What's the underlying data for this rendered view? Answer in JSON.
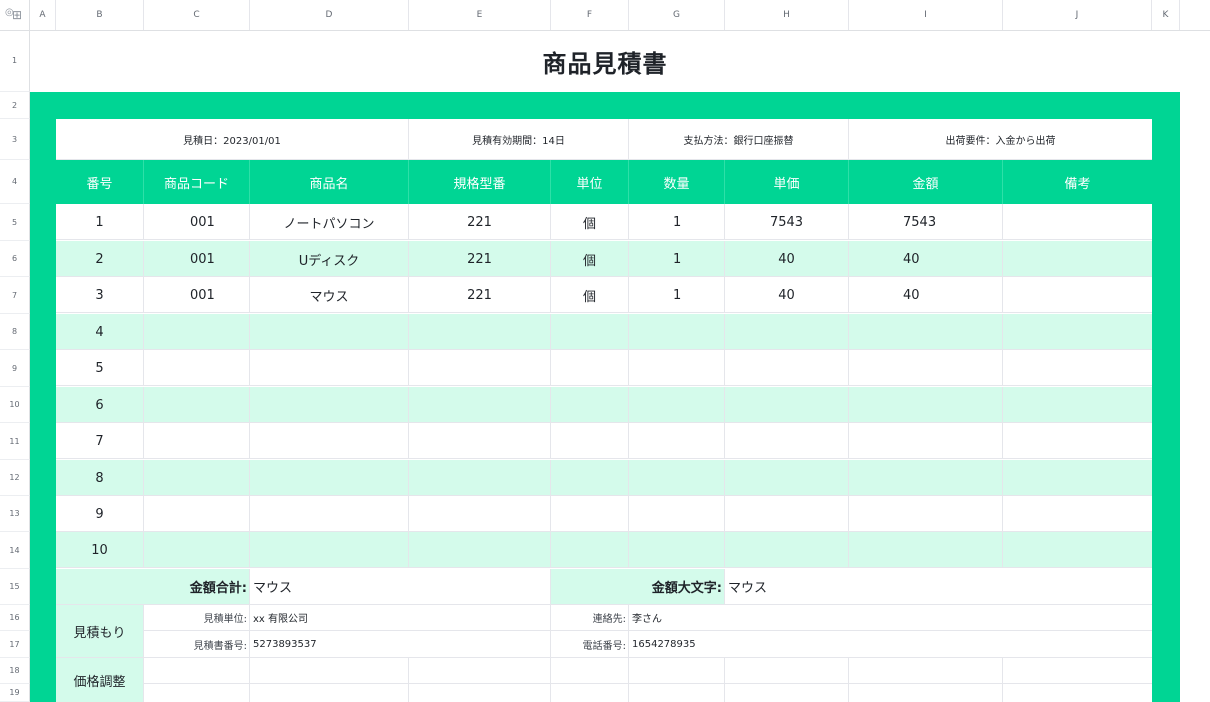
{
  "column_headers": [
    "A",
    "B",
    "C",
    "D",
    "E",
    "F",
    "G",
    "H",
    "I",
    "J",
    "K"
  ],
  "row_numbers": [
    "1",
    "2",
    "3",
    "4",
    "5",
    "6",
    "7",
    "8",
    "9",
    "10",
    "11",
    "12",
    "13",
    "14",
    "15",
    "16",
    "17",
    "18",
    "19"
  ],
  "title": "商品見積書",
  "info": {
    "date": "見積日：2023/01/01",
    "validity": "見積有効期間：14日",
    "payment": "支払方法：銀行口座振替",
    "shipping": "出荷要件：入金から出荷"
  },
  "table_headers": [
    "番号",
    "商品コード",
    "商品名",
    "規格型番",
    "単位",
    "数量",
    "単価",
    "金額",
    "備考"
  ],
  "items": [
    {
      "no": "1",
      "code": "001",
      "name": "ノートパソコン",
      "model": "221",
      "unit": "個",
      "qty": "1",
      "price": "7543",
      "amount": "7543",
      "note": ""
    },
    {
      "no": "2",
      "code": "001",
      "name": "Uディスク",
      "model": "221",
      "unit": "個",
      "qty": "1",
      "price": "40",
      "amount": "40",
      "note": ""
    },
    {
      "no": "3",
      "code": "001",
      "name": "マウス",
      "model": "221",
      "unit": "個",
      "qty": "1",
      "price": "40",
      "amount": "40",
      "note": ""
    },
    {
      "no": "4",
      "code": "",
      "name": "",
      "model": "",
      "unit": "",
      "qty": "",
      "price": "",
      "amount": "",
      "note": ""
    },
    {
      "no": "5",
      "code": "",
      "name": "",
      "model": "",
      "unit": "",
      "qty": "",
      "price": "",
      "amount": "",
      "note": ""
    },
    {
      "no": "6",
      "code": "",
      "name": "",
      "model": "",
      "unit": "",
      "qty": "",
      "price": "",
      "amount": "",
      "note": ""
    },
    {
      "no": "7",
      "code": "",
      "name": "",
      "model": "",
      "unit": "",
      "qty": "",
      "price": "",
      "amount": "",
      "note": ""
    },
    {
      "no": "8",
      "code": "",
      "name": "",
      "model": "",
      "unit": "",
      "qty": "",
      "price": "",
      "amount": "",
      "note": ""
    },
    {
      "no": "9",
      "code": "",
      "name": "",
      "model": "",
      "unit": "",
      "qty": "",
      "price": "",
      "amount": "",
      "note": ""
    },
    {
      "no": "10",
      "code": "",
      "name": "",
      "model": "",
      "unit": "",
      "qty": "",
      "price": "",
      "amount": "",
      "note": ""
    }
  ],
  "totals": {
    "sum_label": "金額合計:",
    "sum_value": "マウス",
    "kanji_label": "金額大文字:",
    "kanji_value": "マウス"
  },
  "estimate": {
    "section_label": "見積もり",
    "unit_label": "見積単位:",
    "unit_value": "xx 有限公司",
    "number_label": "見積書番号:",
    "number_value": "5273893537",
    "contact_label": "連絡先:",
    "contact_value": "李さん",
    "phone_label": "電話番号:",
    "phone_value": "1654278935"
  },
  "price_adjust_label": "価格調整",
  "colors": {
    "green": "#00d594",
    "mint": "#d4fbeb"
  }
}
